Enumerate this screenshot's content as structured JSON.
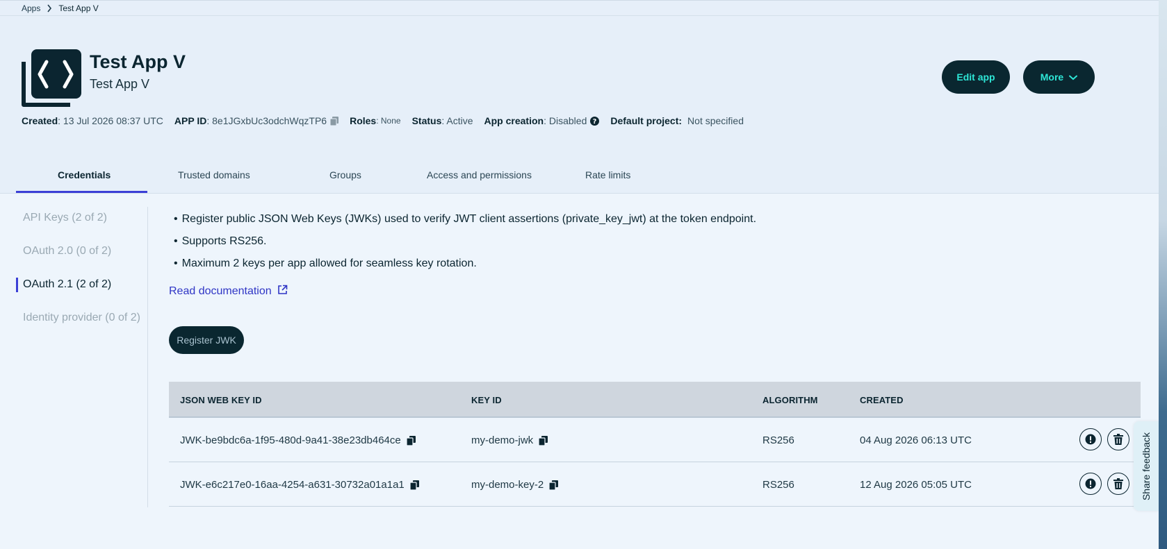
{
  "breadcrumb": {
    "root": "Apps",
    "current": "Test App V"
  },
  "app": {
    "title": "Test App V",
    "subtitle": "Test App V"
  },
  "actions": {
    "edit_label": "Edit app",
    "more_label": "More"
  },
  "meta": {
    "created_label": "Created",
    "created_value": ": 13 Jul 2026 08:37 UTC",
    "appid_label": "APP ID",
    "appid_value": ": 8e1JGxbUc3odchWqzTP6",
    "roles_label": "Roles",
    "roles_value": ": None",
    "status_label": "Status",
    "status_value": ": Active",
    "appcreation_label": "App creation",
    "appcreation_value": ": Disabled",
    "defaultproject_label": "Default project:",
    "defaultproject_value": "Not specified"
  },
  "tabs": [
    {
      "label": "Credentials",
      "active": true
    },
    {
      "label": "Trusted domains"
    },
    {
      "label": "Groups"
    },
    {
      "label": "Access and permissions"
    },
    {
      "label": "Rate limits"
    }
  ],
  "subnav": [
    {
      "label": "API Keys (2 of 2)"
    },
    {
      "label": "OAuth 2.0 (0 of 2)"
    },
    {
      "label": "OAuth 2.1 (2 of 2)",
      "active": true
    },
    {
      "label": "Identity provider (0 of 2)"
    }
  ],
  "content": {
    "bullets": [
      "Register public JSON Web Keys (JWKs) used to verify JWT client assertions (private_key_jwt) at the token endpoint.",
      "Supports RS256.",
      "Maximum 2 keys per app allowed for seamless key rotation."
    ],
    "bullet_glyph": "•",
    "read_doc_label": "Read documentation",
    "register_label": "Register JWK"
  },
  "table": {
    "headers": [
      "JSON WEB KEY ID",
      "KEY ID",
      "ALGORITHM",
      "CREATED"
    ],
    "rows": [
      {
        "jwk_id": "JWK-be9bdc6a-1f95-480d-9a41-38e23db464ce",
        "key_id": "my-demo-jwk",
        "algorithm": "RS256",
        "created": "04 Aug 2026 06:13 UTC"
      },
      {
        "jwk_id": "JWK-e6c217e0-16aa-4254-a631-30732a01a1a1",
        "key_id": "my-demo-key-2",
        "algorithm": "RS256",
        "created": "12 Aug 2026 05:05 UTC"
      }
    ]
  },
  "feedback": {
    "label": "Share feedback"
  },
  "colors": {
    "accent": "#3b3fd6",
    "primary_button": "#0a2730",
    "button_text": "#2ee6d6",
    "link": "#2f35c5"
  },
  "icons": [
    "chevron-right-icon",
    "app-code-icon",
    "copy-icon",
    "help-icon",
    "chevron-down-icon",
    "external-link-icon",
    "info-icon",
    "trash-icon"
  ]
}
